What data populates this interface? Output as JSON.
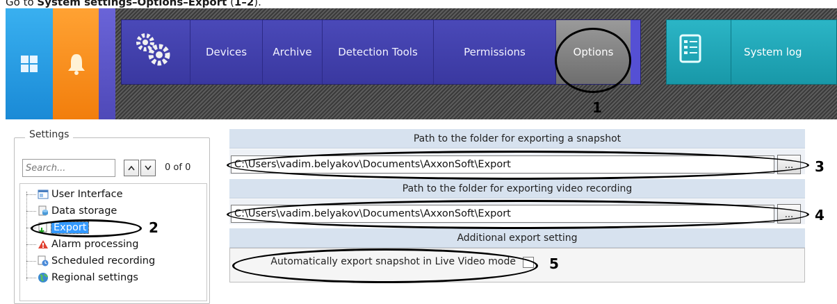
{
  "caption": {
    "prefix": "Go to ",
    "path": "System settings–Options–Export",
    "suffix_open": " (",
    "steps": "1–2",
    "suffix_close": ")."
  },
  "toolbar": {
    "menu_items": [
      "Devices",
      "Archive",
      "Detection Tools",
      "Permissions",
      "Options"
    ],
    "active_item": "Options",
    "system_log": "System log"
  },
  "settings": {
    "group_title": "Settings",
    "search_placeholder": "Search...",
    "search_count": "0 of 0",
    "tree_items": [
      {
        "label": "User Interface",
        "icon": "window-icon"
      },
      {
        "label": "Data storage",
        "icon": "database-icon"
      },
      {
        "label": "Export",
        "icon": "export-icon",
        "selected": true
      },
      {
        "label": "Alarm processing",
        "icon": "alarm-icon"
      },
      {
        "label": "Scheduled recording",
        "icon": "schedule-icon"
      },
      {
        "label": "Regional settings",
        "icon": "globe-icon"
      }
    ]
  },
  "export_settings": {
    "snapshot_header": "Path to the folder for exporting a snapshot",
    "snapshot_path": "C:\\Users\\vadim.belyakov\\Documents\\AxxonSoft\\Export",
    "video_header": "Path to the folder for exporting video recording",
    "video_path": "C:\\Users\\vadim.belyakov\\Documents\\AxxonSoft\\Export",
    "browse_label": "...",
    "additional_header": "Additional export setting",
    "auto_snapshot_label": "Automatically export snapshot in Live Video mode",
    "auto_snapshot_checked": false
  },
  "annotations": [
    "1",
    "2",
    "3",
    "4",
    "5"
  ],
  "colors": {
    "menu_panel": "#4a49b8",
    "syslog_panel": "#2bb5c6",
    "home_tile": "#39b0f0",
    "bell_tile": "#ffa233",
    "selection": "#3399ff"
  }
}
